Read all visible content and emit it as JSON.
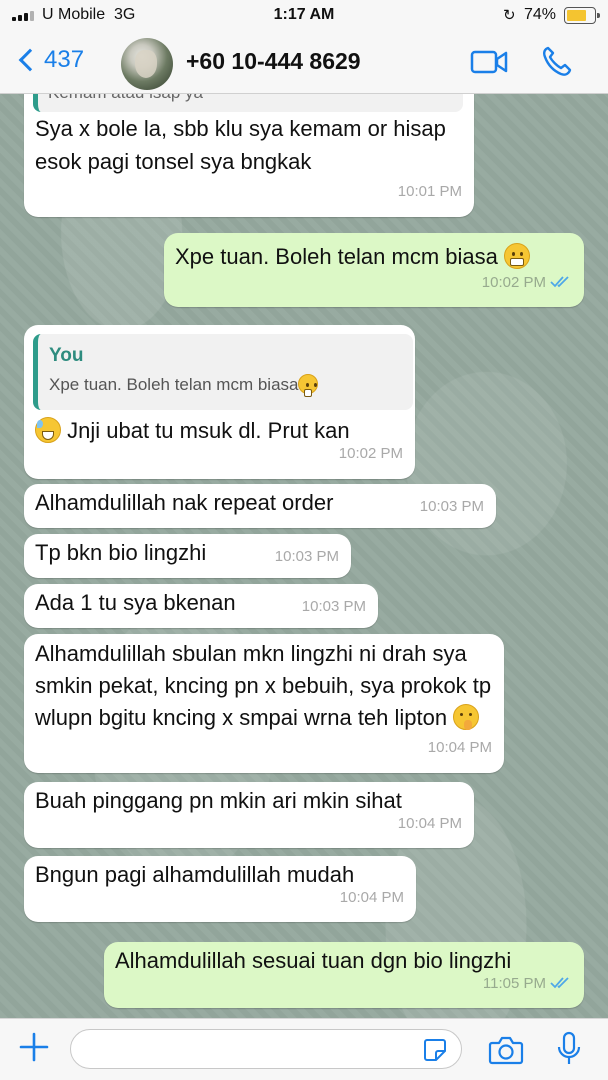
{
  "status_bar": {
    "carrier": "U Mobile",
    "network": "3G",
    "time": "1:17 AM",
    "battery_percent": "74%",
    "battery_level": 0.74
  },
  "header": {
    "back_count": "437",
    "contact_name": "+60 10-444 8629",
    "icons": [
      "back-chevron-icon",
      "video-call-icon",
      "phone-call-icon"
    ]
  },
  "messages": [
    {
      "direction": "in",
      "text": "Sya x bole la, sbb klu sya kemam or hisap esok pagi tonsel sya bngkak",
      "time": "10:01 PM",
      "partial_top_text": "Kemam atau isap ya"
    },
    {
      "direction": "out",
      "text": "Xpe tuan. Boleh telan mcm biasa",
      "emoji": "grimacing-face",
      "time": "10:02 PM",
      "read": true
    },
    {
      "direction": "in",
      "quote_name": "You",
      "quote_text": "Xpe tuan. Boleh telan mcm biasa",
      "text": "Jnji ubat tu msuk dl. Prut kan",
      "lead_emoji": "grinning-sweat-face",
      "time": "10:02 PM"
    },
    {
      "direction": "in",
      "text": "Alhamdulillah nak repeat order",
      "time": "10:03 PM"
    },
    {
      "direction": "in",
      "text": "Tp bkn bio lingzhi",
      "time": "10:03 PM"
    },
    {
      "direction": "in",
      "text": "Ada 1 tu sya bkenan",
      "time": "10:03 PM"
    },
    {
      "direction": "in",
      "text": "Alhamdulillah sbulan mkn lingzhi ni drah sya smkin pekat, kncing pn x bebuih, sya prokok tp wlupn bgitu kncing x smpai wrna teh lipton",
      "emoji": "shushing-face",
      "time": "10:04 PM"
    },
    {
      "direction": "in",
      "text": "Buah pinggang pn mkin ari mkin sihat",
      "time": "10:04 PM"
    },
    {
      "direction": "in",
      "text": "Bngun pagi alhamdulillah mudah",
      "time": "10:04 PM"
    },
    {
      "direction": "out",
      "text": "Alhamdulillah sesuai tuan dgn bio lingzhi",
      "time": "11:05 PM",
      "read": true
    }
  ],
  "input_bar": {
    "placeholder": "",
    "icons": [
      "plus-icon",
      "sticker-icon",
      "camera-icon",
      "microphone-icon"
    ]
  },
  "colors": {
    "accent": "#1a7fe8",
    "outgoing_bubble": "#dcf8c6",
    "incoming_bubble": "#ffffff",
    "read_ticks": "#4fa8e8",
    "quote_bar": "#2e9c8b"
  }
}
